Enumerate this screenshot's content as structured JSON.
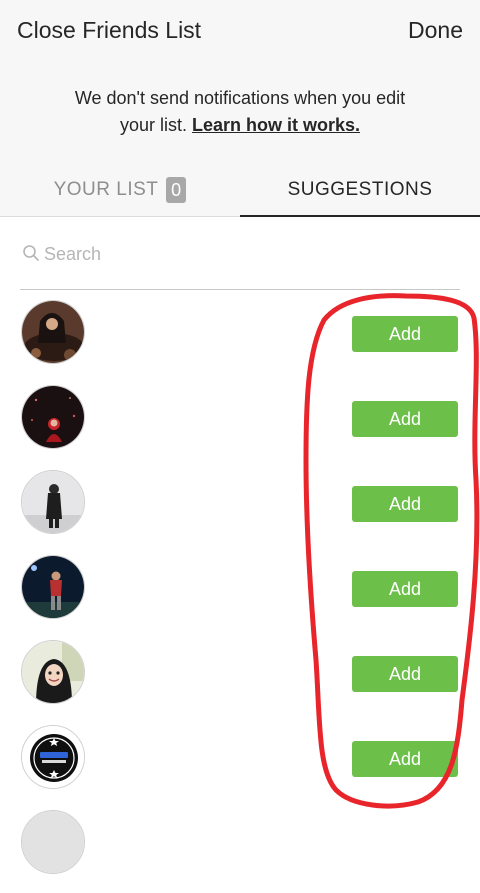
{
  "header": {
    "title": "Close Friends List",
    "done_label": "Done"
  },
  "notice": {
    "line1": "We don't send notifications when you edit",
    "line2_prefix": "your list.",
    "learn_link": "Learn how it works."
  },
  "tabs": [
    {
      "label": "YOUR LIST",
      "count": "0",
      "active": false
    },
    {
      "label": "SUGGESTIONS",
      "active": true
    }
  ],
  "search": {
    "placeholder": "Search",
    "value": "",
    "icon": "search-icon"
  },
  "suggestions": [
    {
      "add_label": "Add"
    },
    {
      "add_label": "Add"
    },
    {
      "add_label": "Add"
    },
    {
      "add_label": "Add"
    },
    {
      "add_label": "Add"
    },
    {
      "add_label": "Add"
    }
  ],
  "colors": {
    "add_button": "#6cc04a",
    "header_bg": "#f7f7f7",
    "annotation": "#e8252b",
    "count_badge": "#a8a8a8"
  }
}
